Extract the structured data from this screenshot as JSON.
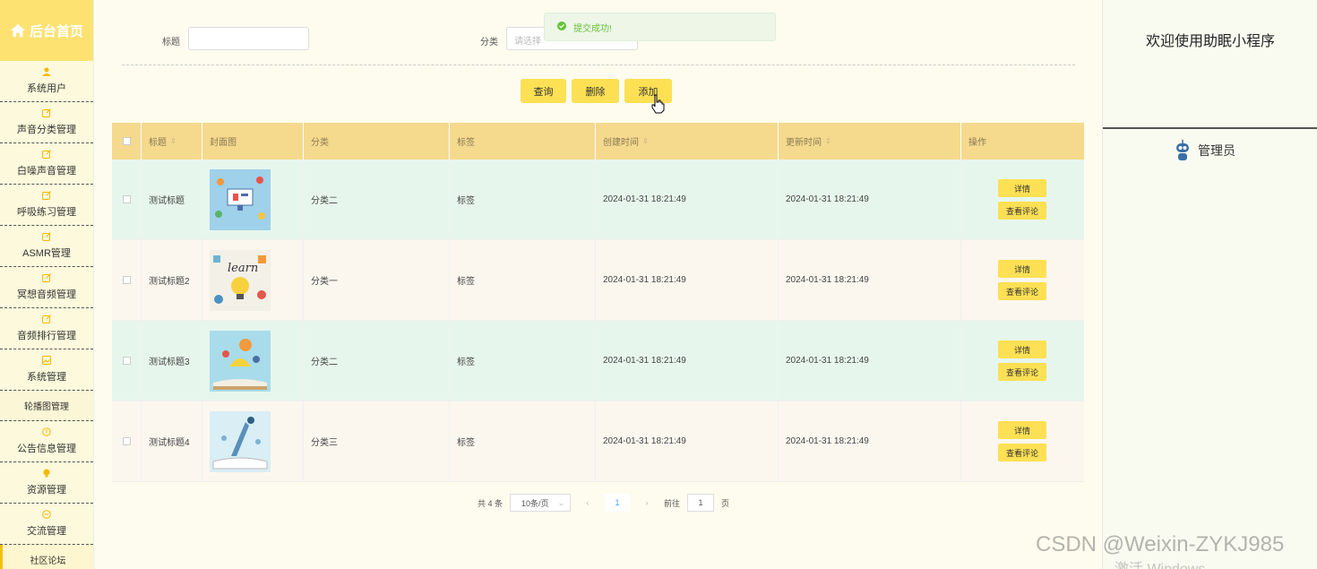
{
  "sidebar": {
    "brand": "后台首页",
    "items": [
      {
        "label": "系统用户",
        "icon": "user-icon"
      },
      {
        "label": "声音分类管理",
        "icon": "edit-icon"
      },
      {
        "label": "白噪声音管理",
        "icon": "edit-icon"
      },
      {
        "label": "呼吸练习管理",
        "icon": "edit-icon"
      },
      {
        "label": "ASMR管理",
        "icon": "edit-icon"
      },
      {
        "label": "冥想音频管理",
        "icon": "edit-icon"
      },
      {
        "label": "音频排行管理",
        "icon": "edit-icon"
      },
      {
        "label": "系统管理",
        "icon": "image-icon"
      }
    ],
    "sub_carousel": "轮播图管理",
    "items2": [
      {
        "label": "公告信息管理",
        "icon": "info-icon"
      },
      {
        "label": "资源管理",
        "icon": "bulb-icon"
      },
      {
        "label": "交流管理",
        "icon": "chat-icon"
      }
    ],
    "sub_forum": "社区论坛"
  },
  "search": {
    "title_label": "标题",
    "title_value": "",
    "category_label": "分类",
    "category_placeholder": "请选择"
  },
  "toolbar": {
    "query_label": "查询",
    "delete_label": "删除",
    "add_label": "添加"
  },
  "toast": {
    "message": "提交成功!"
  },
  "table": {
    "headers": [
      "标题",
      "封面图",
      "分类",
      "标签",
      "创建时间",
      "更新时间",
      "操作"
    ],
    "rows": [
      {
        "title": "测试标题",
        "category": "分类二",
        "tag": "标签",
        "created": "2024-01-31 18:21:49",
        "updated": "2024-01-31 18:21:49"
      },
      {
        "title": "测试标题2",
        "category": "分类一",
        "tag": "标签",
        "created": "2024-01-31 18:21:49",
        "updated": "2024-01-31 18:21:49"
      },
      {
        "title": "测试标题3",
        "category": "分类二",
        "tag": "标签",
        "created": "2024-01-31 18:21:49",
        "updated": "2024-01-31 18:21:49"
      },
      {
        "title": "测试标题4",
        "category": "分类三",
        "tag": "标签",
        "created": "2024-01-31 18:21:49",
        "updated": "2024-01-31 18:21:49"
      }
    ],
    "detail_label": "详情",
    "comments_label": "查看评论"
  },
  "pagination": {
    "total": "共 4 条",
    "page_size": "10条/页",
    "current_page": "1",
    "goto_label": "前往",
    "goto_value": "1",
    "page_suffix": "页"
  },
  "right": {
    "welcome": "欢迎使用助眠小程序",
    "admin": "管理员"
  },
  "watermark": {
    "csdn": "CSDN @Weixin-ZYKJ985",
    "windows": "激活 Windows"
  },
  "colors": {
    "accent": "#fde054",
    "header": "#f5d98d",
    "row_even": "#e7f6ed",
    "row_odd": "#fbf7ee"
  }
}
